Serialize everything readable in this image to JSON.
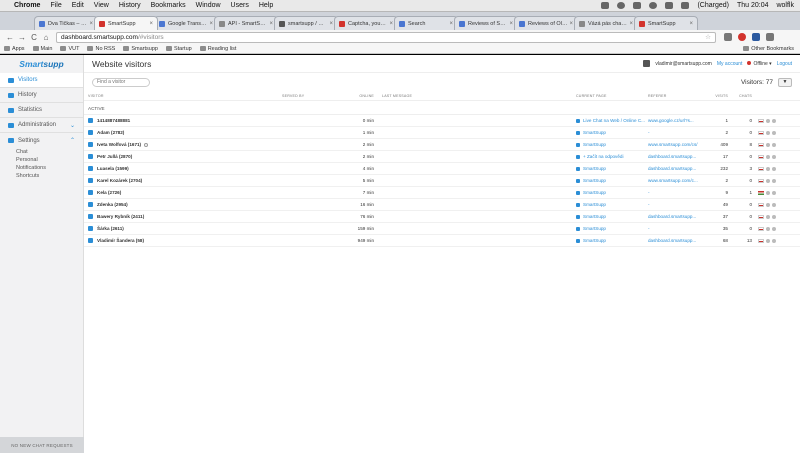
{
  "macos_menubar": {
    "apple": "",
    "items": [
      "Chrome",
      "File",
      "Edit",
      "View",
      "History",
      "Bookmarks",
      "Window",
      "Users",
      "Help"
    ],
    "battery": "(Charged)",
    "clock": "Thu 20:04",
    "user": "wolflk"
  },
  "tabs": [
    {
      "label": "Dva Tičkas – ODjus",
      "favicon_color": "#4a76d1"
    },
    {
      "label": "SmartSupp",
      "favicon_color": "#d2332d",
      "active": true
    },
    {
      "label": "Google Translate",
      "favicon_color": "#4a76d1"
    },
    {
      "label": "API - SmartSupp",
      "favicon_color": "#888888"
    },
    {
      "label": "smartsupp / Chat",
      "favicon_color": "#555555"
    },
    {
      "label": "Captcha, your soft",
      "favicon_color": "#d2332d"
    },
    {
      "label": "Search",
      "favicon_color": "#4a76d1"
    },
    {
      "label": "Reviews of Smartsup",
      "favicon_color": "#4a76d1"
    },
    {
      "label": "Reviews of OlarkHc",
      "favicon_color": "#4a76d1"
    },
    {
      "label": "Vázá pás chats Tulsa",
      "favicon_color": "#888888"
    },
    {
      "label": "SmartSupp",
      "favicon_color": "#d2332d"
    }
  ],
  "toolbar": {
    "back": "←",
    "forward": "→",
    "reload": "C",
    "home": "⌂",
    "url_host": "dashboard.smartsupp.com",
    "url_path": "/#visitors",
    "star": "☆"
  },
  "bookmarks": {
    "items": [
      "Apps",
      "Main",
      "VUT",
      "No RSS",
      "Smartsupp",
      "Startup",
      "Reading list"
    ],
    "other": "Other Bookmarks"
  },
  "sidebar": {
    "logo_part1": "Smart",
    "logo_part2": "supp",
    "items": [
      {
        "label": "Visitors"
      },
      {
        "label": "History"
      },
      {
        "label": "Statistics"
      },
      {
        "label": "Administration"
      },
      {
        "label": "Settings"
      }
    ],
    "settings_sub": [
      "Chat",
      "Personal",
      "Notifications",
      "Shortcuts"
    ],
    "footer": "NO NEW CHAT REQUESTS"
  },
  "header": {
    "title": "Website visitors",
    "user_email": "vladimir@smartsupp.com",
    "my_account": "My account",
    "status": "Offline ▾",
    "logout": "Logout"
  },
  "filters": {
    "search_placeholder": "Find a visitor",
    "visitors_label": "Visitors: 77",
    "filter_button": "▼"
  },
  "table": {
    "columns": {
      "visitor": "VISITOR",
      "served_by": "SERVED BY",
      "online": "ONLINE",
      "last_message": "LAST MESSAGE",
      "current_page": "CURRENT PAGE",
      "referer": "REFERER",
      "visits": "VISITS",
      "chats": "CHATS"
    },
    "group": "ACTIVE",
    "rows": [
      {
        "visitor": "1414887488881",
        "online": "0 min",
        "page": "Live Chat na Web / Online C...",
        "referer": "www.google.cz/url?s...",
        "visits": "1",
        "chats": "0",
        "flag": "cz"
      },
      {
        "visitor": "Adam (2782)",
        "online": "1 min",
        "page": "SmartSupp",
        "referer": "-",
        "visits": "2",
        "chats": "0",
        "flag": "cz"
      },
      {
        "visitor": "Iveta Wolfová (1671)",
        "online": "2 min",
        "page": "SmartSupp",
        "referer": "www.smartsupp.com/cs/",
        "visits": "409",
        "chats": "8",
        "flag": "cz",
        "info": true
      },
      {
        "visitor": "Petr Jullá (2870)",
        "online": "2 min",
        "page": "+ Začít na odpovědi",
        "referer": "dashboard.smartsupp...",
        "visits": "17",
        "chats": "0",
        "flag": "cz"
      },
      {
        "visitor": "Luasela (1599)",
        "online": "4 min",
        "page": "SmartSupp",
        "referer": "dashboard.smartsupp...",
        "visits": "232",
        "chats": "3",
        "flag": "cz"
      },
      {
        "visitor": "Karel Kozárek (2704)",
        "online": "5 min",
        "page": "SmartSupp",
        "referer": "www.smartsupp.com/c...",
        "visits": "2",
        "chats": "0",
        "flag": "cz"
      },
      {
        "visitor": "Kela (2726)",
        "online": "7 min",
        "page": "SmartSupp",
        "referer": "-",
        "visits": "9",
        "chats": "1",
        "flag": "hu"
      },
      {
        "visitor": "Zdenka (2954)",
        "online": "16 min",
        "page": "SmartSupp",
        "referer": "-",
        "visits": "49",
        "chats": "0",
        "flag": "cz"
      },
      {
        "visitor": "Bawery Rybník (2411)",
        "online": "76 min",
        "page": "SmartSupp",
        "referer": "dashboard.smartsupp...",
        "visits": "37",
        "chats": "0",
        "flag": "cz"
      },
      {
        "visitor": "Šárka (2611)",
        "online": "159 min",
        "page": "SmartSupp",
        "referer": "-",
        "visits": "35",
        "chats": "0",
        "flag": "cz"
      },
      {
        "visitor": "Vladimír Šandera (58)",
        "online": "949 min",
        "page": "SmartSupp",
        "referer": "dashboard.smartsupp...",
        "visits": "68",
        "chats": "13",
        "flag": "cz"
      }
    ]
  }
}
